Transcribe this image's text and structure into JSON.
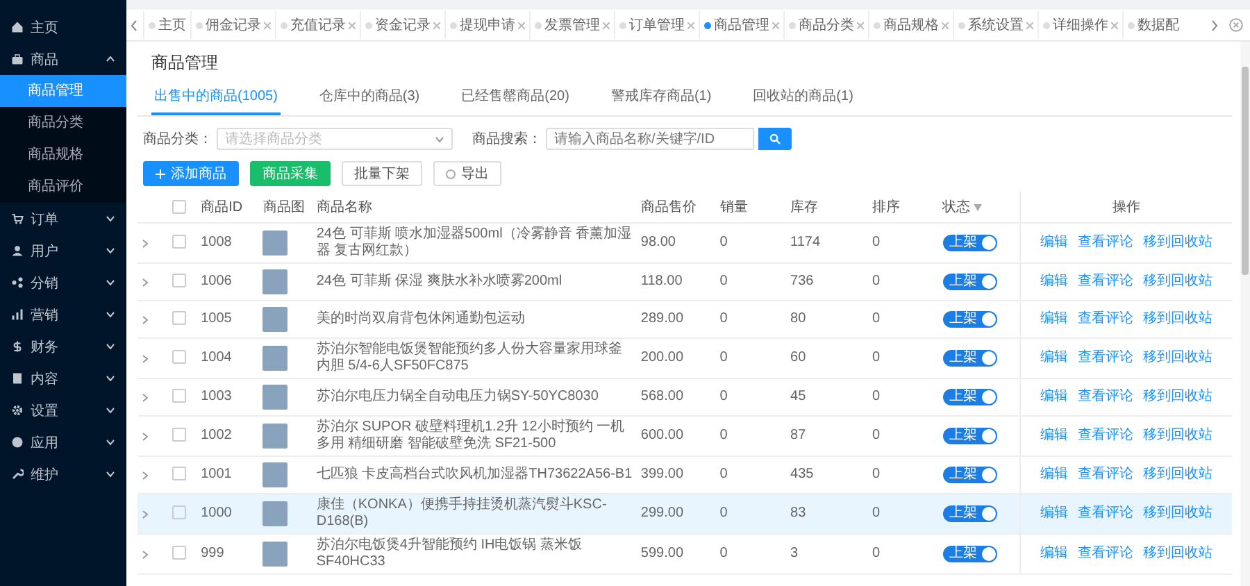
{
  "sidebar": {
    "items": [
      {
        "label": "主页"
      },
      {
        "label": "商品",
        "expanded": true,
        "children": [
          {
            "label": "商品管理",
            "selected": true
          },
          {
            "label": "商品分类",
            "selected": false
          },
          {
            "label": "商品规格",
            "selected": false
          },
          {
            "label": "商品评价",
            "selected": false
          }
        ]
      },
      {
        "label": "订单",
        "expanded": false
      },
      {
        "label": "用户",
        "expanded": false
      },
      {
        "label": "分销",
        "expanded": false
      },
      {
        "label": "营销",
        "expanded": false
      },
      {
        "label": "财务",
        "expanded": false
      },
      {
        "label": "内容",
        "expanded": false
      },
      {
        "label": "设置",
        "expanded": false
      },
      {
        "label": "应用",
        "expanded": false
      },
      {
        "label": "维护",
        "expanded": false
      }
    ]
  },
  "tabs": [
    {
      "label": "主页",
      "selected": false,
      "closable": false
    },
    {
      "label": "佣金记录",
      "selected": false,
      "closable": true
    },
    {
      "label": "充值记录",
      "selected": false,
      "closable": true
    },
    {
      "label": "资金记录",
      "selected": false,
      "closable": true
    },
    {
      "label": "提现申请",
      "selected": false,
      "closable": true
    },
    {
      "label": "发票管理",
      "selected": false,
      "closable": true
    },
    {
      "label": "订单管理",
      "selected": false,
      "closable": true
    },
    {
      "label": "商品管理",
      "selected": true,
      "closable": true
    },
    {
      "label": "商品分类",
      "selected": false,
      "closable": true
    },
    {
      "label": "商品规格",
      "selected": false,
      "closable": true
    },
    {
      "label": "系统设置",
      "selected": false,
      "closable": true
    },
    {
      "label": "详细操作",
      "selected": false,
      "closable": true
    },
    {
      "label": "数据配",
      "selected": false,
      "closable": false
    }
  ],
  "page_title": "商品管理",
  "sub_tabs": [
    {
      "label": "出售中的商品(1005)",
      "selected": true
    },
    {
      "label": "仓库中的商品(3)",
      "selected": false
    },
    {
      "label": "已经售罄商品(20)",
      "selected": false
    },
    {
      "label": "警戒库存商品(1)",
      "selected": false
    },
    {
      "label": "回收站的商品(1)",
      "selected": false
    }
  ],
  "filters": [
    {
      "label": "商品分类：",
      "kind": "select",
      "placeholder": "请选择商品分类"
    },
    {
      "label": "商品搜索：",
      "kind": "search",
      "placeholder": "请输入商品名称/关键字/ID"
    }
  ],
  "actions": [
    {
      "label": "添加商品",
      "kind": "primary"
    },
    {
      "label": "商品采集",
      "kind": "success"
    },
    {
      "label": "批量下架",
      "kind": "default"
    },
    {
      "label": "导出",
      "kind": "export"
    }
  ],
  "table": {
    "all_checked": false,
    "columns": [
      "商品ID",
      "商品图",
      "商品名称",
      "商品售价",
      "销量",
      "库存",
      "排序",
      "状态",
      "操作"
    ],
    "rows": [
      {
        "id": "1008",
        "name": "24色 可菲斯 喷水加湿器500ml（冷雾静音 香薰加湿器 复古网红款）",
        "price": "98.00",
        "sales": "0",
        "stock": "1174",
        "sort": "0",
        "status": {
          "label": "上架",
          "on": true
        },
        "checked": false,
        "selected": false,
        "actions": [
          "编辑",
          "查看评论",
          "移到回收站"
        ]
      },
      {
        "id": "1006",
        "name": "24色 可菲斯 保湿 爽肤水补水喷雾200ml",
        "price": "118.00",
        "sales": "0",
        "stock": "736",
        "sort": "0",
        "status": {
          "label": "上架",
          "on": true
        },
        "checked": false,
        "selected": false,
        "actions": [
          "编辑",
          "查看评论",
          "移到回收站"
        ]
      },
      {
        "id": "1005",
        "name": "美的时尚双肩背包休闲通勤包运动",
        "price": "289.00",
        "sales": "0",
        "stock": "80",
        "sort": "0",
        "status": {
          "label": "上架",
          "on": true
        },
        "checked": false,
        "selected": false,
        "actions": [
          "编辑",
          "查看评论",
          "移到回收站"
        ]
      },
      {
        "id": "1004",
        "name": "苏泊尔智能电饭煲智能预约多人份大容量家用球釜内胆 5/4-6人SF50FC875",
        "price": "200.00",
        "sales": "0",
        "stock": "60",
        "sort": "0",
        "status": {
          "label": "上架",
          "on": true
        },
        "checked": false,
        "selected": false,
        "actions": [
          "编辑",
          "查看评论",
          "移到回收站"
        ]
      },
      {
        "id": "1003",
        "name": "苏泊尔电压力锅全自动电压力锅SY-50YC8030",
        "price": "568.00",
        "sales": "0",
        "stock": "45",
        "sort": "0",
        "status": {
          "label": "上架",
          "on": true
        },
        "checked": false,
        "selected": false,
        "actions": [
          "编辑",
          "查看评论",
          "移到回收站"
        ]
      },
      {
        "id": "1002",
        "name": "苏泊尔 SUPOR 破壁料理机1.2升 12小时预约 一机多用 精细研磨 智能破壁免洗 SF21-500",
        "price": "600.00",
        "sales": "0",
        "stock": "87",
        "sort": "0",
        "status": {
          "label": "上架",
          "on": true
        },
        "checked": false,
        "selected": false,
        "actions": [
          "编辑",
          "查看评论",
          "移到回收站"
        ]
      },
      {
        "id": "1001",
        "name": "七匹狼 卡皮高档台式吹风机加湿器TH73622A56-B1",
        "price": "399.00",
        "sales": "0",
        "stock": "435",
        "sort": "0",
        "status": {
          "label": "上架",
          "on": true
        },
        "checked": false,
        "selected": false,
        "actions": [
          "编辑",
          "查看评论",
          "移到回收站"
        ]
      },
      {
        "id": "1000",
        "name": "康佳（KONKA）便携手持挂烫机蒸汽熨斗KSC-D168(B)",
        "price": "299.00",
        "sales": "0",
        "stock": "83",
        "sort": "0",
        "status": {
          "label": "上架",
          "on": true
        },
        "checked": false,
        "selected": true,
        "actions": [
          "编辑",
          "查看评论",
          "移到回收站"
        ]
      },
      {
        "id": "999",
        "name": "苏泊尔电饭煲4升智能预约 IH电饭锅 蒸米饭 SF40HC33",
        "price": "599.00",
        "sales": "0",
        "stock": "3",
        "sort": "0",
        "status": {
          "label": "上架",
          "on": true
        },
        "checked": false,
        "selected": false,
        "actions": [
          "编辑",
          "查看评论",
          "移到回收站"
        ]
      }
    ]
  }
}
